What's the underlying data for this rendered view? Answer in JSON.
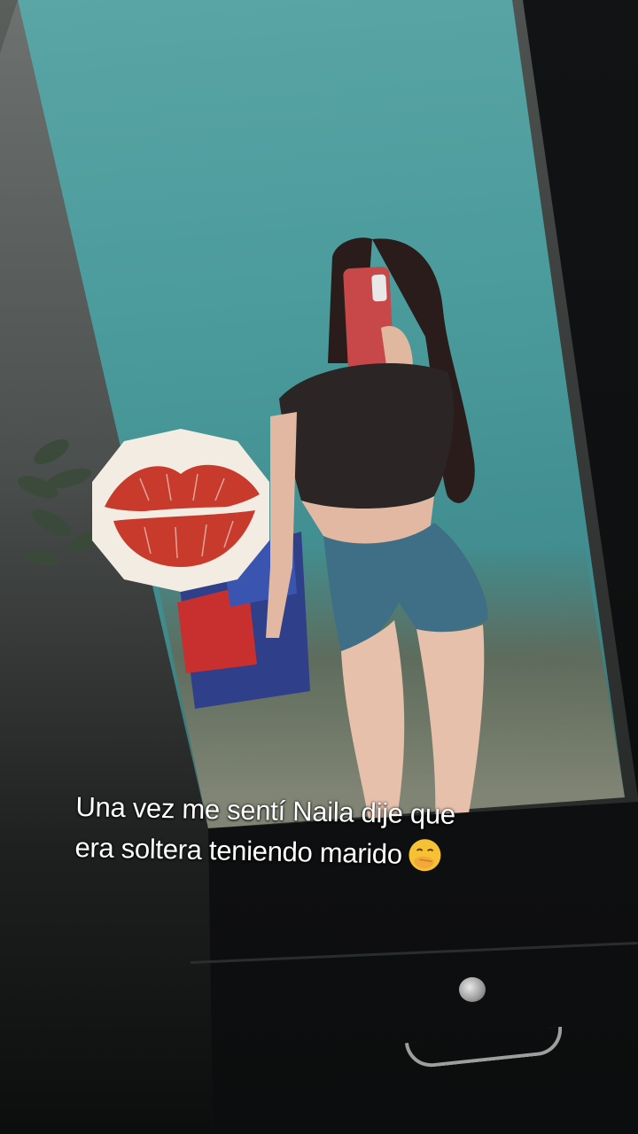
{
  "caption": {
    "line1": "Una vez me sentí Naila dije que",
    "line2": "era soltera teniendo marido",
    "emoji": "face-with-hand-over-mouth-icon"
  },
  "sticker": {
    "icon": "kiss-lips-icon",
    "color": "#c83a2c"
  },
  "colors": {
    "wall": "#4a9a9c",
    "shirt": "#2b2526",
    "shorts": "#3f6f86",
    "phone": "#c8484a"
  }
}
